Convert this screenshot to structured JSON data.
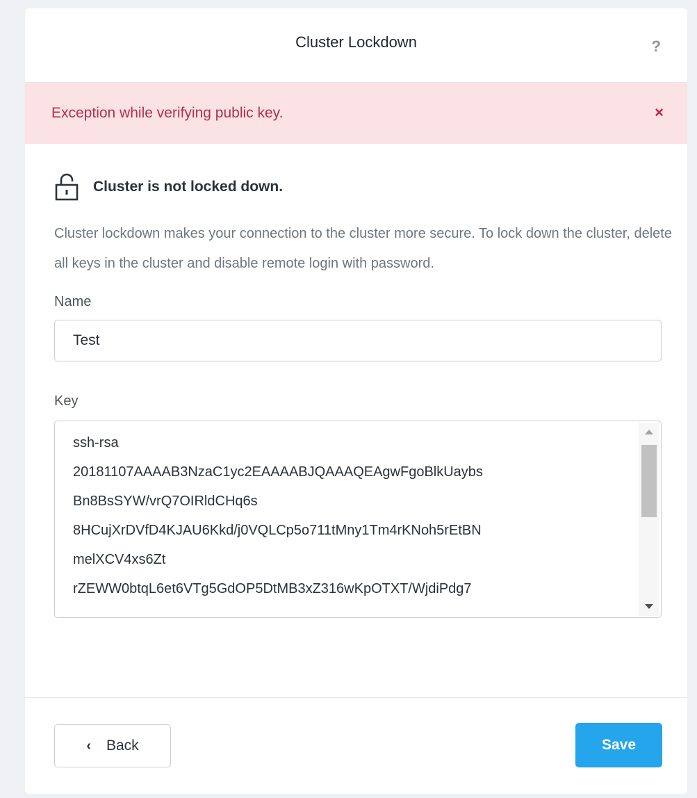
{
  "dialog": {
    "title": "Cluster Lockdown",
    "help_label": "?"
  },
  "alert": {
    "message": "Exception while verifying public key.",
    "close_label": "×"
  },
  "status": {
    "icon": "unlocked-padlock-icon",
    "text": "Cluster is not locked down."
  },
  "description": "Cluster lockdown makes your connection to the cluster more secure. To lock down the cluster, delete all keys in the cluster and disable remote login with password.",
  "form": {
    "name_label": "Name",
    "name_value": "Test",
    "key_label": "Key",
    "key_value": "ssh-rsa\n20181107AAAAB3NzaC1yc2EAAAABJQAAAQEAgwFgoBlkUaybs\nBn8BsSYW/vrQ7OIRldCHq6s\n8HCujXrDVfD4KJAU6Kkd/j0VQLCp5o711tMny1Tm4rKNoh5rEtBN\nmelXCV4xs6Zt\nrZEWW0btqL6et6VTg5GdOP5DtMB3xZ316wKpOTXT/WjdiPdg7"
  },
  "footer": {
    "back_icon": "chevron-left-icon",
    "back_chevron": "‹",
    "back_label": "Back",
    "save_label": "Save"
  },
  "colors": {
    "alert_bg": "#fbe3e5",
    "alert_text": "#b3304a",
    "primary": "#24a5ec"
  }
}
